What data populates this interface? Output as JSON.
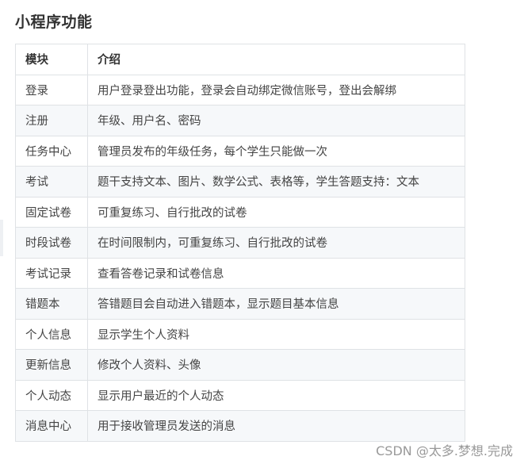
{
  "heading": "小程序功能",
  "table": {
    "headers": [
      "模块",
      "介绍"
    ],
    "rows": [
      [
        "登录",
        "用户登录登出功能，登录会自动绑定微信账号，登出会解绑"
      ],
      [
        "注册",
        "年级、用户名、密码"
      ],
      [
        "任务中心",
        "管理员发布的年级任务，每个学生只能做一次"
      ],
      [
        "考试",
        "题干支持文本、图片、数学公式、表格等，学生答题支持：文本"
      ],
      [
        "固定试卷",
        "可重复练习、自行批改的试卷"
      ],
      [
        "时段试卷",
        "在时间限制内，可重复练习、自行批改的试卷"
      ],
      [
        "考试记录",
        "查看答卷记录和试卷信息"
      ],
      [
        "错题本",
        "答错题目会自动进入错题本，显示题目基本信息"
      ],
      [
        "个人信息",
        "显示学生个人资料"
      ],
      [
        "更新信息",
        "修改个人资料、头像"
      ],
      [
        "个人动态",
        "显示用户最近的个人动态"
      ],
      [
        "消息中心",
        "用于接收管理员发送的消息"
      ]
    ]
  },
  "watermark": "CSDN @太多.梦想.完成"
}
